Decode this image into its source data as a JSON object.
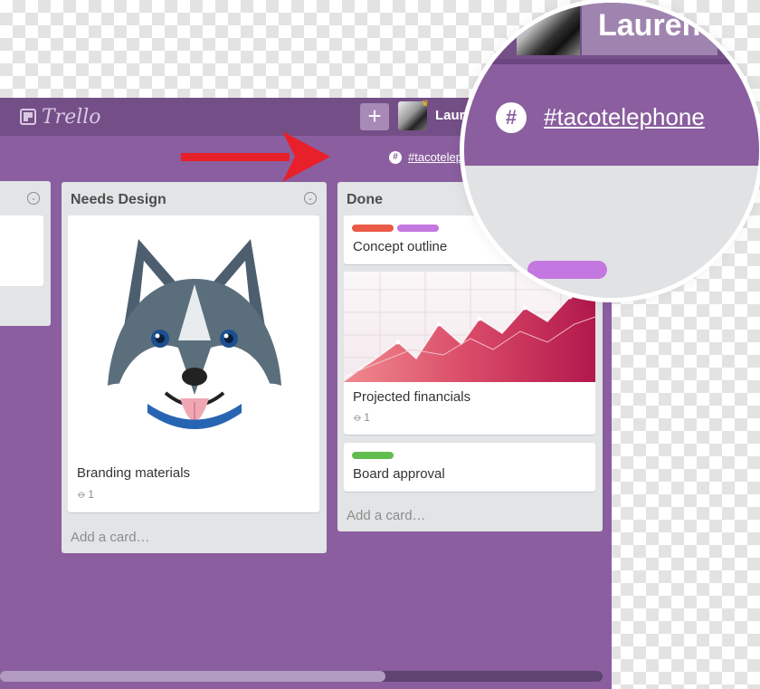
{
  "header": {
    "logo_text": "Trello",
    "add_button_label": "+",
    "user_name": "Laure"
  },
  "channel": {
    "link_text": "#tacotelep",
    "icon_label": "#"
  },
  "lists": {
    "needs_design": {
      "title": "Needs Design",
      "cards": [
        {
          "title": "Branding materials",
          "attachments": "1"
        }
      ],
      "add_card": "Add a card…"
    },
    "done": {
      "title": "Done",
      "cards": [
        {
          "title": "Concept outline",
          "labels": [
            "#eb5a46",
            "#c377e0"
          ]
        },
        {
          "title": "Projected financials",
          "attachments": "1"
        },
        {
          "title": "Board approval",
          "labels": [
            "#61bd4f"
          ]
        }
      ],
      "add_card": "Add a card…"
    }
  },
  "zoom": {
    "user_name": "Lauren",
    "channel_link": "#tacotelephone",
    "icon_label": "#"
  },
  "colors": {
    "board_bg": "#8a5e9f",
    "header_bg": "#744f87",
    "list_bg": "#e2e4e6",
    "arrow": "#e8202a"
  },
  "icons": {
    "logo": "trello-logo-icon",
    "slack": "slack-hash-icon",
    "attachment": "paperclip-icon",
    "list_menu": "chevron-down-circle-icon",
    "arrow": "red-arrow-icon"
  },
  "scroll": {
    "horizontal_fraction": 0.64
  }
}
